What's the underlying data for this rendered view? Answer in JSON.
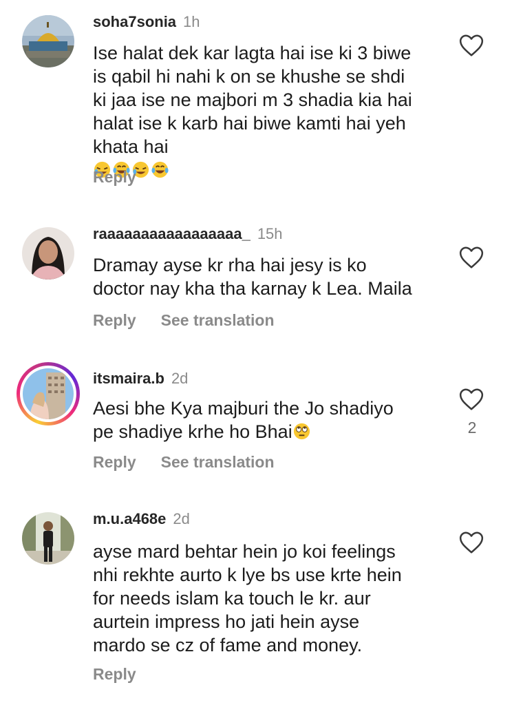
{
  "comments": [
    {
      "username": "soha7sonia",
      "time": "1h",
      "text": "Ise halat dek kar lagta hai ise ki 3 biwe\nis qabil hi nahi k on se khushe se shdi\nki jaa ise ne majbori m 3 shadia kia hai\nhalat ise k karb hai biwe kamti hai yeh\nkhata hai",
      "emojis": [
        "rofl-emoji",
        "joy-emoji",
        "rofl-emoji",
        "joy-emoji"
      ],
      "reply_label": "Reply",
      "like_count": ""
    },
    {
      "username": "raaaaaaaaaaaaaaaaa_",
      "time": "15h",
      "text": "Dramay ayse kr rha hai jesy is ko\ndoctor nay kha tha karnay k Lea. Maila",
      "reply_label": "Reply",
      "translate_label": "See translation",
      "like_count": ""
    },
    {
      "username": "itsmaira.b",
      "time": "2d",
      "text": "Aesi bhe Kya majburi the Jo shadiyo\npe shadiye krhe ho Bhai",
      "emojis": [
        "eye-roll-emoji"
      ],
      "reply_label": "Reply",
      "translate_label": "See translation",
      "like_count": "2"
    },
    {
      "username": "m.u.a468e",
      "time": "2d",
      "text": "ayse mard behtar hein jo koi feelings\nnhi rekhte aurto k lye bs use krte hein\nfor needs islam ka touch le kr. aur\naurtein impress ho jati hein ayse\nmardo se cz of fame and money.",
      "reply_label": "Reply",
      "like_count": ""
    }
  ],
  "colors": {
    "secondary_text": "#8a8a8a",
    "story_ring_start": "#f9ce34",
    "story_ring_end": "#6228d7"
  }
}
